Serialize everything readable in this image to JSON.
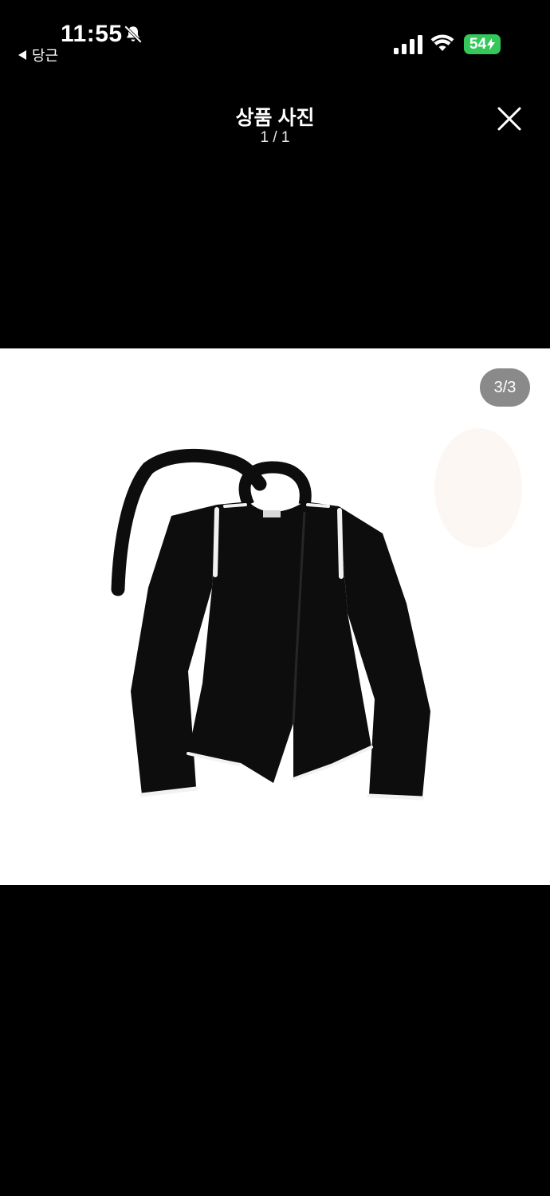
{
  "status_bar": {
    "time": "11:55",
    "back_app": "당근",
    "battery": "54",
    "icons": [
      "bell-slash-icon",
      "back-arrow-icon",
      "signal-icon",
      "wifi-icon",
      "bolt-icon"
    ]
  },
  "header": {
    "title": "상품 사진",
    "counter": "1 / 1",
    "close_icon": "close-icon"
  },
  "photo": {
    "badge": "3/3",
    "subject": "cardigan-image",
    "colors": {
      "garment": "#0d0d0d",
      "trim": "#f2f2f2",
      "background": "#ffffff"
    }
  }
}
